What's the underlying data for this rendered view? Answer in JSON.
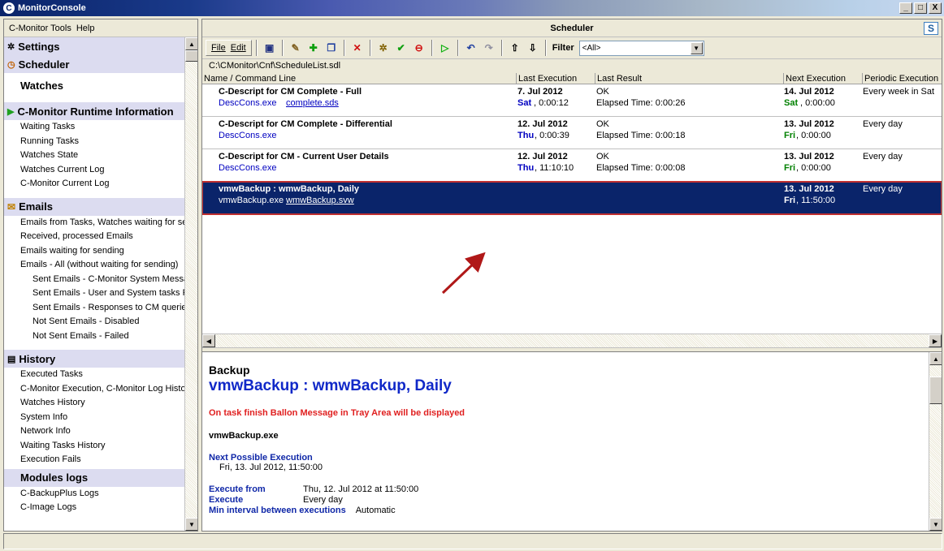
{
  "window": {
    "title": "MonitorConsole",
    "app_icon": "C",
    "min": "_",
    "max": "□",
    "close": "X"
  },
  "left_menu": {
    "tools": "C-Monitor Tools",
    "help": "Help"
  },
  "nav": {
    "settings": "Settings",
    "scheduler": "Scheduler",
    "watches": "Watches",
    "runtime": "C-Monitor Runtime Information",
    "runtime_items": [
      "Waiting Tasks",
      "Running Tasks",
      "Watches State",
      "Watches Current Log",
      "C-Monitor Current Log"
    ],
    "emails": "Emails",
    "email_items": [
      "Emails from Tasks, Watches waiting for sending",
      "Received, processed Emails",
      "Emails waiting for sending",
      "Emails - All (without waiting for sending)"
    ],
    "email_subitems": [
      "Sent Emails - C-Monitor System Messages",
      "Sent Emails - User and System tasks Results",
      "Sent Emails - Responses to CM queries",
      "Not Sent Emails - Disabled",
      "Not Sent Emails - Failed"
    ],
    "history": "History",
    "history_items": [
      "Executed Tasks",
      "C-Monitor Execution, C-Monitor Log History",
      "Watches History",
      "System Info",
      "Network Info",
      "Waiting Tasks History",
      "Execution Fails"
    ],
    "modules": "Modules logs",
    "module_items": [
      "C-BackupPlus Logs",
      "C-Image Logs"
    ]
  },
  "pane": {
    "title": "Scheduler"
  },
  "toolbar": {
    "file": "File",
    "edit": "Edit",
    "filter_label": "Filter",
    "filter_value": "<All>"
  },
  "path": "C:\\CMonitor\\Cnf\\ScheduleList.sdl",
  "columns": [
    "Name / Command Line",
    "Last Execution",
    "Last Result",
    "Next Execution",
    "Periodic Execution"
  ],
  "rows": [
    {
      "name": "C-Descript for CM Complete - Full",
      "cmd": "DescCons.exe",
      "arg": "complete.sds",
      "last_date": "7. Jul 2012",
      "last_day": "Sat",
      "last_time": ", 0:00:12",
      "result": "OK",
      "elapsed": "Elapsed Time: 0:00:26",
      "next_date": "14. Jul 2012",
      "next_day": "Sat",
      "next_time": ", 0:00:00",
      "periodic": "Every week in Sat"
    },
    {
      "name": "C-Descript for CM Complete - Differential",
      "cmd": "DescCons.exe",
      "arg": "",
      "last_date": "12. Jul 2012",
      "last_day": "Thu",
      "last_time": ", 0:00:39",
      "result": "OK",
      "elapsed": "Elapsed Time: 0:00:18",
      "next_date": "13. Jul 2012",
      "next_day": "Fri",
      "next_time": ", 0:00:00",
      "periodic": "Every day"
    },
    {
      "name": "C-Descript for CM - Current User Details",
      "cmd": "DescCons.exe",
      "arg": "",
      "last_date": "12. Jul 2012",
      "last_day": "Thu",
      "last_time": ", 11:10:10",
      "result": "OK",
      "elapsed": "Elapsed Time: 0:00:08",
      "next_date": "13. Jul 2012",
      "next_day": "Fri",
      "next_time": ", 0:00:00",
      "periodic": "Every day"
    },
    {
      "name": "vmwBackup : wmwBackup, Daily",
      "cmd": "vmwBackup.exe",
      "arg": "wmwBackup.svw",
      "last_date": "",
      "last_day": "",
      "last_time": "",
      "result": "",
      "elapsed": "",
      "next_date": "13. Jul 2012",
      "next_day": "Fri",
      "next_time": ", 11:50:00",
      "periodic": "Every day"
    }
  ],
  "detail": {
    "category": "Backup",
    "title": "vmwBackup : wmwBackup, Daily",
    "message": "On task finish Ballon Message in Tray Area will be displayed",
    "exe": "vmwBackup.exe",
    "next_label": "Next Possible Execution",
    "next_value": "Fri, 13. Jul 2012, 11:50:00",
    "exec_from_label": "Execute from",
    "exec_from_value": "Thu, 12. Jul 2012 at 11:50:00",
    "execute_label": "Execute",
    "execute_value": "Every day",
    "min_interval_label": "Min interval between executions",
    "min_interval_value": "Automatic"
  },
  "colors": {
    "selection": "#0a246a",
    "link": "#0000c0",
    "green_day": "#008000",
    "detail_title": "#1028c8",
    "warning": "#e02020",
    "arrow": "#b01818"
  }
}
